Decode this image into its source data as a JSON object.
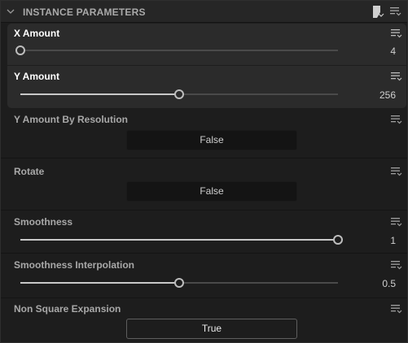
{
  "header": {
    "title": "INSTANCE PARAMETERS",
    "icons": [
      "chevron-down-icon",
      "copy-icon",
      "options-menu-icon"
    ]
  },
  "params": {
    "x_amount": {
      "label": "X Amount",
      "value": "4",
      "fraction": 0.0
    },
    "y_amount": {
      "label": "Y Amount",
      "value": "256",
      "fraction": 0.5
    },
    "y_amount_by_resolution": {
      "label": "Y Amount By Resolution",
      "value": "False"
    },
    "rotate": {
      "label": "Rotate",
      "value": "False"
    },
    "smoothness": {
      "label": "Smoothness",
      "value": "1",
      "fraction": 1.0
    },
    "smoothness_interpolation": {
      "label": "Smoothness Interpolation",
      "value": "0.5",
      "fraction": 0.5
    },
    "non_square_expansion": {
      "label": "Non Square Expansion",
      "value": "True"
    }
  },
  "colors": {
    "panel_bg": "#1d1d1d",
    "selected_bg": "#2b2b2b",
    "slider_fill": "#c8c8c8",
    "text": "#d6d6d6"
  }
}
